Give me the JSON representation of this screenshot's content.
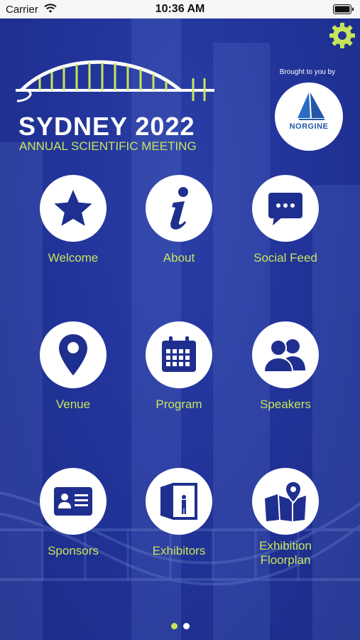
{
  "status_bar": {
    "carrier": "Carrier",
    "time": "10:36 AM"
  },
  "header": {
    "event_title": "SYDNEY 2022",
    "event_subtitle": "ANNUAL SCIENTIFIC MEETING",
    "brought_by": "Brought to you by",
    "sponsor_name": "NORGINE"
  },
  "tiles": [
    {
      "label": "Welcome",
      "icon": "star-icon"
    },
    {
      "label": "About",
      "icon": "info-icon"
    },
    {
      "label": "Social Feed",
      "icon": "chat-bubble-icon"
    },
    {
      "label": "Venue",
      "icon": "map-pin-icon"
    },
    {
      "label": "Program",
      "icon": "calendar-icon"
    },
    {
      "label": "Speakers",
      "icon": "people-icon"
    },
    {
      "label": "Sponsors",
      "icon": "id-card-icon"
    },
    {
      "label": "Exhibitors",
      "icon": "exhibit-booth-icon"
    },
    {
      "label": "Exhibition\nFloorplan",
      "icon": "folded-map-icon"
    }
  ],
  "pagination": {
    "active_color": "#c7e55a",
    "inactive_color": "#ffffff"
  },
  "colors": {
    "accent": "#c7e55a",
    "background": "#1e2f8f",
    "icon": "#1f2f8f"
  }
}
